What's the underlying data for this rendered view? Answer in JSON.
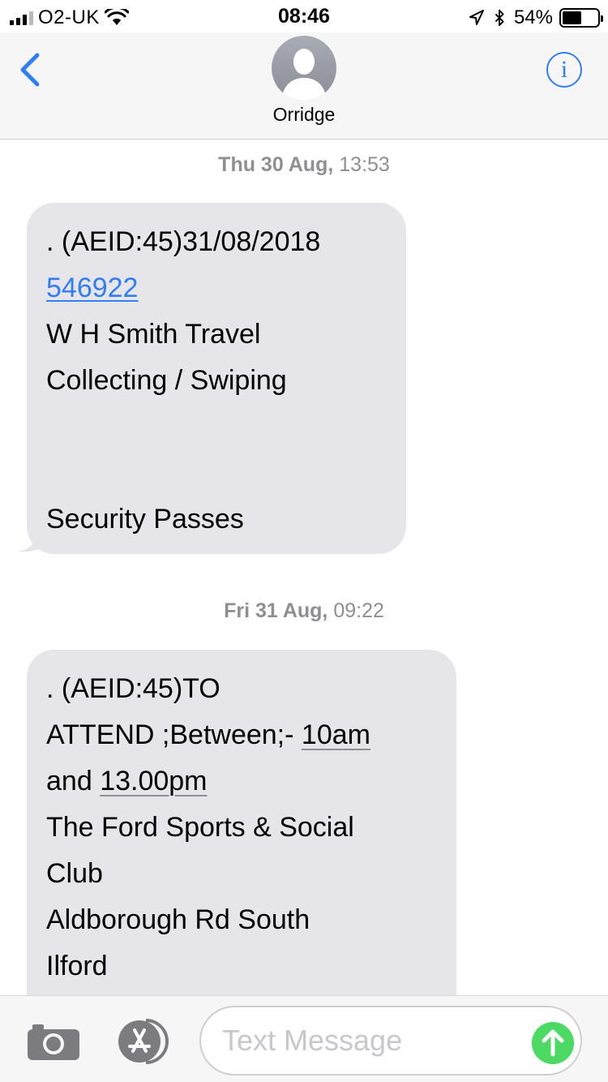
{
  "status_bar": {
    "carrier": "O2-UK",
    "time": "08:46",
    "battery_percent": "54%",
    "battery_level": 0.54,
    "icons": [
      "signal-icon",
      "wifi-icon",
      "location-icon",
      "bluetooth-icon",
      "battery-icon"
    ]
  },
  "header": {
    "contact_name": "Orridge",
    "back_icon": "chevron-left-icon",
    "info_icon": "info-icon",
    "info_glyph": "i",
    "accent_color": "#2f7ef6"
  },
  "messages": [
    {
      "timestamp_day": "Thu 30 Aug,",
      "timestamp_time": "13:53",
      "lines": [
        ". (AEID:45)31/08/2018",
        "546922",
        "W H Smith Travel",
        "Collecting / Swiping",
        "",
        "",
        "Security Passes"
      ]
    },
    {
      "timestamp_day": "Fri 31 Aug,",
      "timestamp_time": "09:22",
      "lines": [
        ". (AEID:45)TO",
        "ATTEND ;Between;- ",
        "10am",
        "and ",
        "13.00pm",
        "The Ford Sports & Social",
        "Club",
        "Aldborough Rd South",
        "Ilford"
      ]
    }
  ],
  "input_bar": {
    "placeholder": "Text Message",
    "camera_icon": "camera-icon",
    "apps_icon": "app-store-icon",
    "send_icon": "send-arrow-icon",
    "send_color": "#4cd964"
  },
  "colors": {
    "bubble": "#e5e5ea",
    "timestamp": "#8e8e93",
    "nav_background": "#f6f6f6"
  }
}
